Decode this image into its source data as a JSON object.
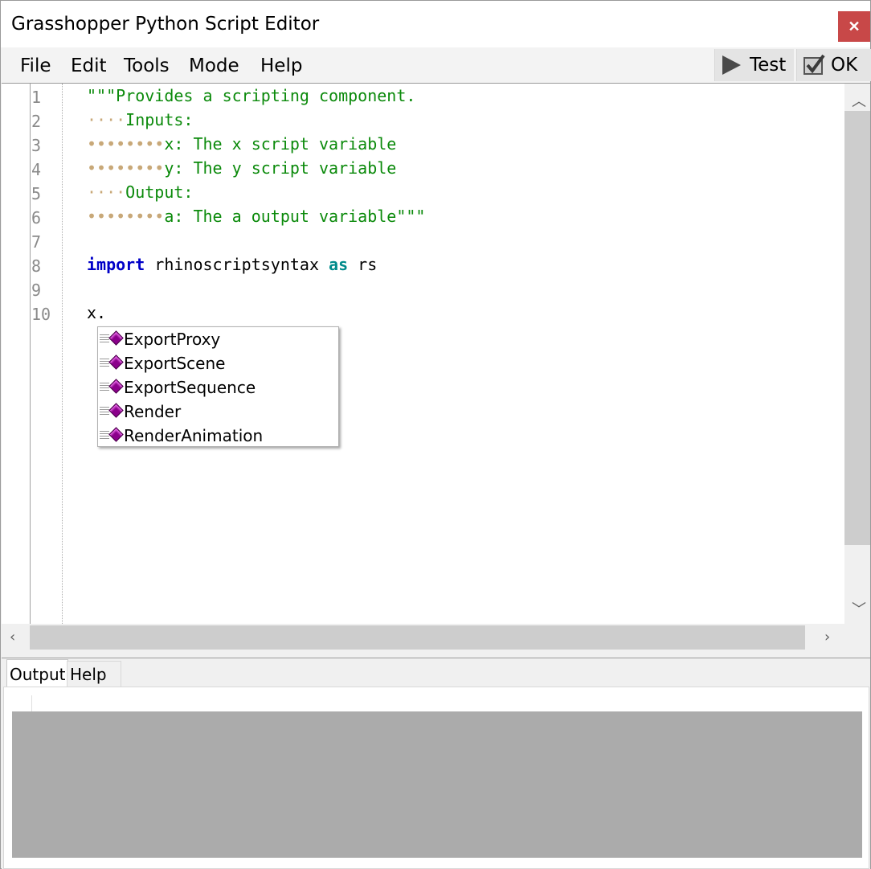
{
  "window": {
    "title": "Grasshopper Python Script Editor",
    "close_glyph": "✕"
  },
  "menu": {
    "items": [
      "File",
      "Edit",
      "Tools",
      "Mode",
      "Help"
    ]
  },
  "toolbar": {
    "test_label": "Test",
    "ok_label": "OK"
  },
  "editor": {
    "line_numbers": [
      "1",
      "2",
      "3",
      "4",
      "5",
      "6",
      "7",
      "8",
      "9",
      "10"
    ],
    "lines": {
      "l1": "\"\"\"Provides a scripting component.",
      "l2_ws": "····",
      "l2": "Inputs:",
      "l3_ws": "••••••••",
      "l3": "x: The x script variable",
      "l4_ws": "••••••••",
      "l4": "y: The y script variable",
      "l5_ws": "····",
      "l5": "Output:",
      "l6_ws": "••••••••",
      "l6": "a: The a output variable\"\"\"",
      "l8_kw": "import",
      "l8_mod": " rhinoscriptsyntax ",
      "l8_as": "as",
      "l8_alias": " rs",
      "l10": "x."
    }
  },
  "autocomplete": {
    "items": [
      "ExportProxy",
      "ExportScene",
      "ExportSequence",
      "Render",
      "RenderAnimation"
    ]
  },
  "output_panel": {
    "tabs": [
      "Output",
      "Help"
    ]
  },
  "colors": {
    "string": "#0b8a0b",
    "keyword": "#0000c8",
    "keyword2": "#008b8b",
    "close": "#c84848",
    "method_icon": "#8b008b"
  }
}
